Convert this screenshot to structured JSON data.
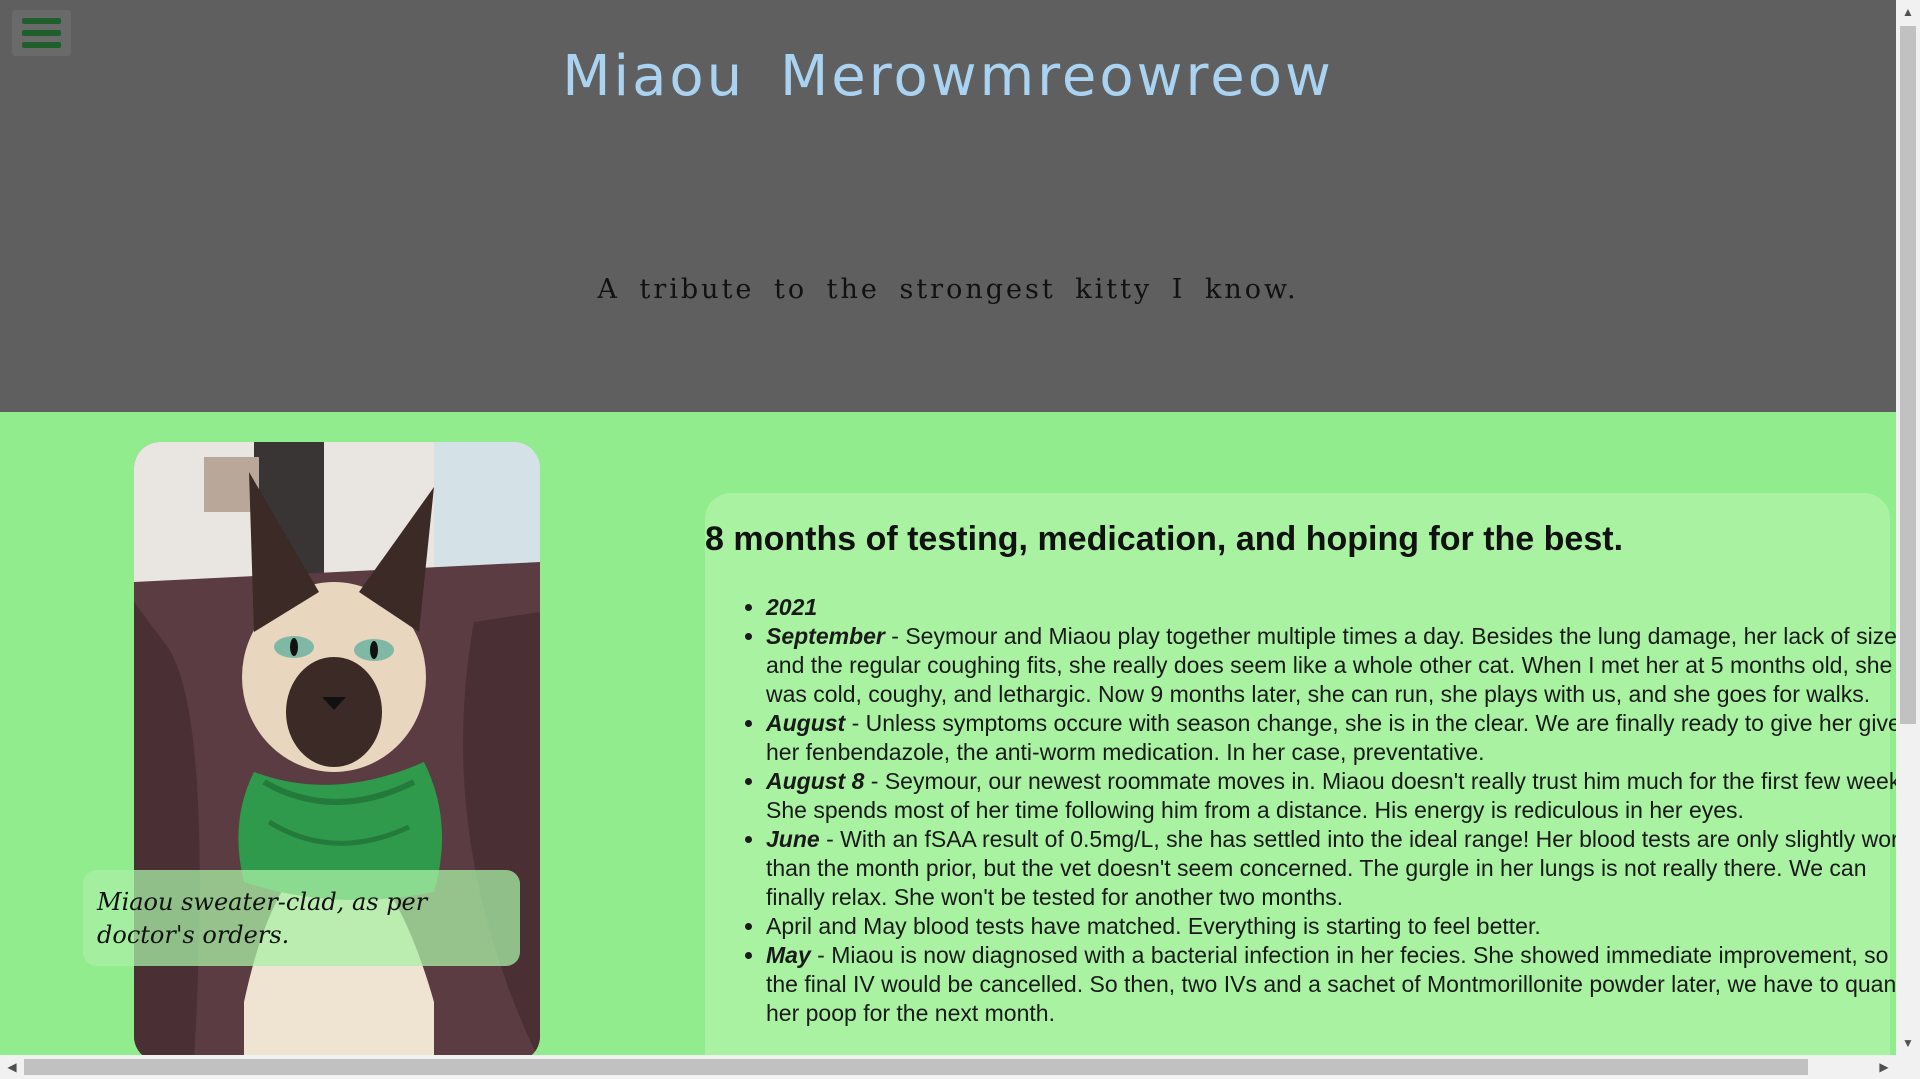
{
  "header": {
    "menu_icon": "hamburger-menu-icon",
    "title": "Miaou  Merowmreowreow",
    "tagline": "A tribute to the strongest kitty I know."
  },
  "photo": {
    "alt": "Siamese cat in green sweater",
    "caption": "Miaou sweater-clad, as per doctor's orders."
  },
  "content": {
    "heading": "8 months of testing, medication, and hoping for the best.",
    "entries": [
      {
        "when": "2021",
        "text": ""
      },
      {
        "when": "September",
        "text": " - Seymour and Miaou play together multiple times a day. Besides the lung damage, her lack of size, and the regular coughing fits, she really does seem like a whole other cat. When I met her at 5 months old, she was cold, coughy, and lethargic. Now 9 months later, she can run, she plays with us, and she goes for walks."
      },
      {
        "when": "August",
        "text": " - Unless symptoms occure with season change, she is in the clear. We are finally ready to give her give her fenbendazole, the anti-worm medication. In her case, preventative."
      },
      {
        "when": "August 8",
        "text": " - Seymour, our newest roommate moves in. Miaou doesn't really trust him much for the first few weeks. She spends most of her time following him from a distance. His energy is rediculous in her eyes."
      },
      {
        "when": "June",
        "text": " - With an fSAA result of 0.5mg/L, she has settled into the ideal range! Her blood tests are only slightly worse than the month prior, but the vet doesn't seem concerned. The gurgle in her lungs is not really there. We can finally relax. She won't be tested for another two months."
      },
      {
        "when": "",
        "text": "April and May blood tests have matched. Everything is starting to feel better."
      },
      {
        "when": "May",
        "text": " - Miaou is now diagnosed with a bacterial infection in her fecies. She showed immediate improvement, so the final IV would be cancelled. So then, two IVs and a sachet of Montmorillonite powder later, we have to quantify her poop for the next month."
      }
    ]
  },
  "scrollbars": {
    "up_arrow": "▲",
    "down_arrow": "▼",
    "left_arrow": "◀",
    "right_arrow": "▶"
  },
  "colors": {
    "header_bg": "#5f5f60",
    "title": "#a9d3f1",
    "page_bg": "#90ec8d",
    "card_bg": "#a8f2a2",
    "menu_icon": "#1e5f2b"
  }
}
